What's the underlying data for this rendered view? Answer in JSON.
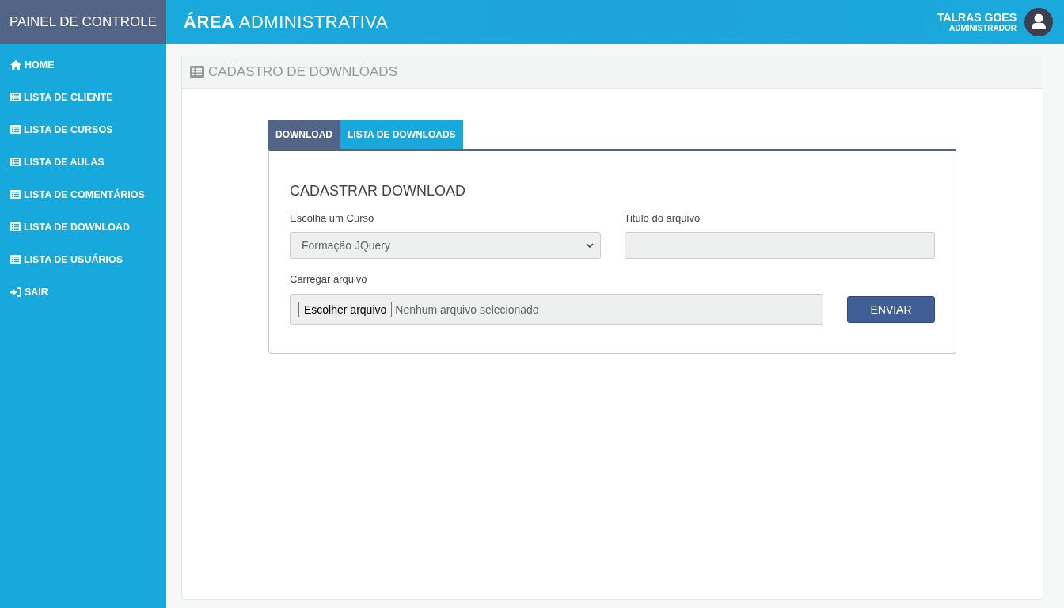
{
  "sidebar": {
    "title": "PAINEL DE CONTROLE",
    "items": [
      {
        "label": "HOME",
        "kind": "home"
      },
      {
        "label": "LISTA DE CLIENTE",
        "kind": "list"
      },
      {
        "label": "LISTA DE CURSOS",
        "kind": "list"
      },
      {
        "label": "LISTA DE AULAS",
        "kind": "list"
      },
      {
        "label": "LISTA DE COMENTÁRIOS",
        "kind": "list"
      },
      {
        "label": "LISTA DE DOWNLOAD",
        "kind": "list"
      },
      {
        "label": "LISTA DE USUÁRIOS",
        "kind": "list"
      },
      {
        "label": "SAIR",
        "kind": "exit"
      }
    ]
  },
  "header": {
    "title": "**ÁREA** ADMINISTRATIVA",
    "user_name": "TALRAS GOES",
    "user_role": "ADMINISTRADOR"
  },
  "panel": {
    "title": "CADASTRO DE DOWNLOADS",
    "tabs": [
      {
        "label": "DOWNLOAD",
        "selected": true
      },
      {
        "label": "LISTA DE DOWNLOADS",
        "selected": false
      }
    ],
    "form": {
      "heading": "CADASTRAR DOWNLOAD",
      "course": {
        "label": "Escolha um Curso",
        "value": "Formação JQuery"
      },
      "file_title": {
        "label": "Titulo do arquivo"
      },
      "upload": {
        "label": "Carregar arquivo",
        "button": "Escolher arquivo",
        "status": "Nenhum arquivo selecionado"
      },
      "submit": "ENVIAR"
    }
  }
}
